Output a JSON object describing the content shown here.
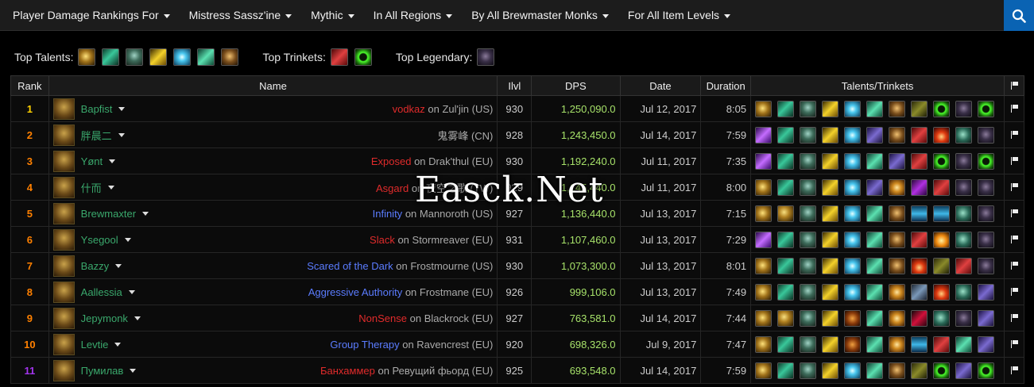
{
  "nav": {
    "items": [
      "Player Damage Rankings For",
      "Mistress Sassz'ine",
      "Mythic",
      "In All Regions",
      "By All Brewmaster Monks",
      "For All Item Levels"
    ]
  },
  "summary": {
    "top_talents_label": "Top Talents:",
    "top_trinkets_label": "Top Trinkets:",
    "top_legendary_label": "Top Legendary:",
    "top_talents": [
      "gold",
      "green",
      "monk",
      "yellow",
      "cyan",
      "jade",
      "brown"
    ],
    "top_trinkets": [
      "red",
      "ring"
    ],
    "top_legendary": [
      "shadow"
    ]
  },
  "table": {
    "headers": [
      "Rank",
      "Name",
      "Ilvl",
      "DPS",
      "Date",
      "Duration",
      "Talents/Trinkets"
    ],
    "rows": [
      {
        "rank": "1",
        "rank_color": "#ffd100",
        "name": "Bapfist",
        "guild": "vodkaz",
        "guild_color": "red",
        "server": "on Zul'jin (US)",
        "ilvl": "930",
        "dps": "1,250,090.0",
        "date": "Jul 12, 2017",
        "duration": "8:05",
        "icons": [
          "gold",
          "green",
          "monk",
          "yellow",
          "cyan",
          "jade",
          "brown",
          "olive",
          "ring",
          "shadow",
          "ring"
        ]
      },
      {
        "rank": "2",
        "rank_color": "#ff8000",
        "name": "胖晨二",
        "guild": "",
        "guild_color": "gray",
        "server": "鬼雾峰 (CN)",
        "ilvl": "928",
        "dps": "1,243,450.0",
        "date": "Jul 14, 2017",
        "duration": "7:59",
        "icons": [
          "purple",
          "green",
          "monk",
          "yellow",
          "cyan",
          "violet",
          "brown",
          "red",
          "fire",
          "sphere",
          "shadow"
        ]
      },
      {
        "rank": "3",
        "rank_color": "#ff8000",
        "name": "Yønt",
        "guild": "Exposed",
        "guild_color": "red",
        "server": "on Drak'thul (EU)",
        "ilvl": "930",
        "dps": "1,192,240.0",
        "date": "Jul 11, 2017",
        "duration": "7:35",
        "icons": [
          "purple",
          "green",
          "monk",
          "yellow",
          "cyan",
          "jade",
          "violet",
          "red",
          "ring",
          "shadow",
          "ring"
        ]
      },
      {
        "rank": "4",
        "rank_color": "#ff8000",
        "name": "什而",
        "guild": "Asgard",
        "guild_color": "red",
        "server": "on 夜空之歌 (TW)",
        "ilvl": "929",
        "dps": "1,145,440.0",
        "date": "Jul 11, 2017",
        "duration": "8:00",
        "icons": [
          "gold",
          "green",
          "monk",
          "yellow",
          "cyan",
          "violet",
          "eye",
          "magenta",
          "red",
          "shadow",
          "shadow"
        ]
      },
      {
        "rank": "5",
        "rank_color": "#ff8000",
        "name": "Brewmaxter",
        "guild": "Infinity",
        "guild_color": "blue",
        "server": "on Mannoroth (US)",
        "ilvl": "927",
        "dps": "1,136,440.0",
        "date": "Jul 13, 2017",
        "duration": "7:15",
        "icons": [
          "gold",
          "swirl",
          "monk",
          "yellow",
          "cyan",
          "jade",
          "brown",
          "blue",
          "blue",
          "sphere",
          "shadow"
        ]
      },
      {
        "rank": "6",
        "rank_color": "#ff8000",
        "name": "Ysegool",
        "guild": "Slack",
        "guild_color": "red",
        "server": "on Stormreaver (EU)",
        "ilvl": "931",
        "dps": "1,107,460.0",
        "date": "Jul 13, 2017",
        "duration": "7:29",
        "icons": [
          "purple",
          "green",
          "monk",
          "yellow",
          "cyan",
          "jade",
          "brown",
          "red",
          "orange",
          "sphere",
          "shadow"
        ]
      },
      {
        "rank": "7",
        "rank_color": "#ff8000",
        "name": "Bazzy",
        "guild": "Scared of the Dark",
        "guild_color": "blue",
        "server": "on Frostmourne (US)",
        "ilvl": "930",
        "dps": "1,073,300.0",
        "date": "Jul 13, 2017",
        "duration": "8:01",
        "icons": [
          "gold",
          "green",
          "monk",
          "yellow",
          "cyan",
          "jade",
          "brown",
          "fire",
          "olive",
          "red",
          "shadow"
        ]
      },
      {
        "rank": "8",
        "rank_color": "#ff8000",
        "name": "Aallessia",
        "guild": "Aggressive Authority",
        "guild_color": "blue",
        "server": "on Frostmane (EU)",
        "ilvl": "926",
        "dps": "999,106.0",
        "date": "Jul 13, 2017",
        "duration": "7:49",
        "icons": [
          "gold",
          "green",
          "monk",
          "yellow",
          "cyan",
          "jade",
          "eye",
          "steel",
          "fire",
          "sphere",
          "violet"
        ]
      },
      {
        "rank": "9",
        "rank_color": "#ff8000",
        "name": "Jepymonk",
        "guild": "NonSense",
        "guild_color": "red",
        "server": "on Blackrock (EU)",
        "ilvl": "927",
        "dps": "763,581.0",
        "date": "Jul 14, 2017",
        "duration": "7:44",
        "icons": [
          "gold",
          "swirl",
          "monk",
          "yellow",
          "tiger",
          "jade",
          "eye",
          "crimson",
          "sphere",
          "shadow",
          "violet"
        ]
      },
      {
        "rank": "10",
        "rank_color": "#ff8000",
        "name": "Levtie",
        "guild": "Group Therapy",
        "guild_color": "blue",
        "server": "on Ravencrest (EU)",
        "ilvl": "920",
        "dps": "698,326.0",
        "date": "Jul 9, 2017",
        "duration": "7:47",
        "icons": [
          "gold",
          "green",
          "monk",
          "yellow",
          "tiger",
          "jade",
          "eye",
          "blue",
          "red",
          "jade",
          "violet"
        ]
      },
      {
        "rank": "11",
        "rank_color": "#a335ee",
        "name": "Пумилав",
        "guild": "Банхаммер",
        "guild_color": "red",
        "server": "on Ревущий фьорд (EU)",
        "ilvl": "925",
        "dps": "693,548.0",
        "date": "Jul 14, 2017",
        "duration": "7:59",
        "icons": [
          "gold",
          "green",
          "monk",
          "yellow",
          "cyan",
          "jade",
          "brown",
          "olive",
          "ring",
          "violet",
          "ring"
        ]
      }
    ]
  },
  "watermark": "Easck.Net"
}
